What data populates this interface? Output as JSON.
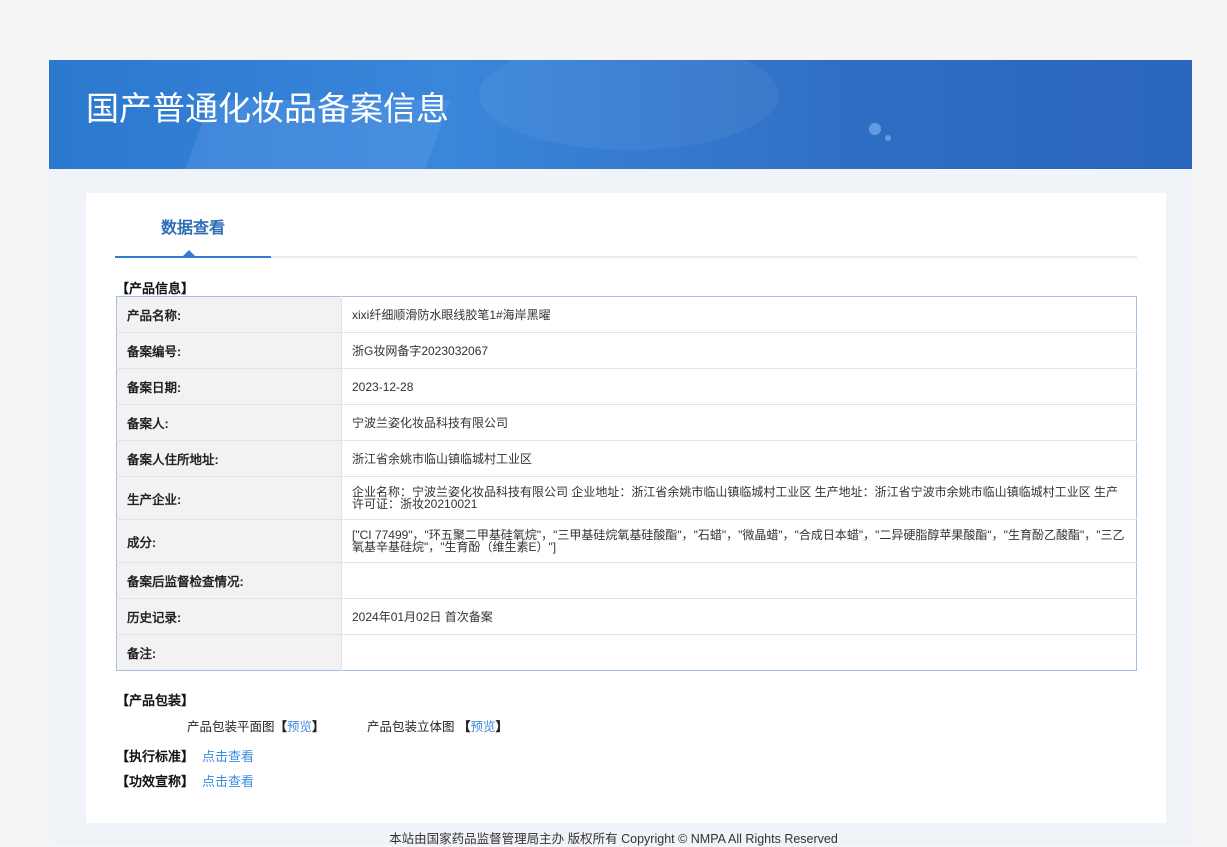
{
  "header": {
    "title": "国产普通化妆品备案信息"
  },
  "tabs": [
    {
      "label": "数据查看",
      "active": true
    }
  ],
  "product_info": {
    "section_title": "【产品信息】",
    "rows": [
      {
        "label": "产品名称:",
        "value": "xixi纤细顺滑防水眼线胶笔1#海岸黑曜"
      },
      {
        "label": "备案编号:",
        "value": "浙G妆网备字2023032067"
      },
      {
        "label": "备案日期:",
        "value": "2023-12-28"
      },
      {
        "label": "备案人:",
        "value": "宁波兰姿化妆品科技有限公司"
      },
      {
        "label": "备案人住所地址:",
        "value": "浙江省余姚市临山镇临城村工业区"
      },
      {
        "label": "生产企业:",
        "value": "企业名称：宁波兰姿化妆品科技有限公司 企业地址：浙江省余姚市临山镇临城村工业区 生产地址：浙江省宁波市余姚市临山镇临城村工业区 生产许可证：浙妆20210021"
      },
      {
        "label": "成分:",
        "value": "[\"CI 77499\"，\"环五聚二甲基硅氧烷\"，\"三甲基硅烷氧基硅酸酯\"，\"石蜡\"，\"微晶蜡\"，\"合成日本蜡\"，\"二异硬脂醇苹果酸酯\"，\"生育酚乙酸酯\"，\"三乙氧基辛基硅烷\"，\"生育酚（维生素E）\"]"
      },
      {
        "label": "备案后监督检查情况:",
        "value": ""
      },
      {
        "label": "历史记录:",
        "value": "2024年01月02日 首次备案"
      },
      {
        "label": "备注:",
        "value": ""
      }
    ]
  },
  "packaging": {
    "section_title": "【产品包装】",
    "flat_label": "产品包装平面图",
    "solid_label": "产品包装立体图",
    "bracket_open": "【",
    "bracket_close": "】",
    "preview": "预览"
  },
  "standard": {
    "label": "【执行标准】",
    "link": "点击查看"
  },
  "efficacy": {
    "label": "【功效宣称】",
    "link": "点击查看"
  },
  "footer": {
    "text": "本站由国家药品监督管理局主办 版权所有 Copyright © NMPA All Rights Reserved"
  }
}
